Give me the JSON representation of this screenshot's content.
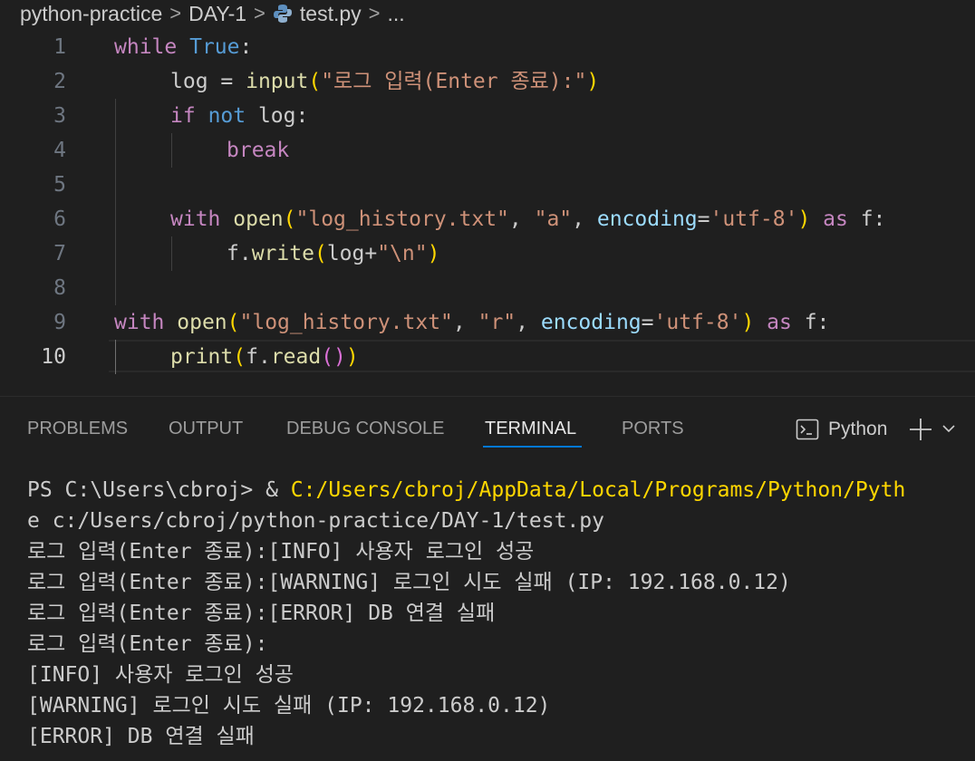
{
  "breadcrumb": {
    "items": [
      "python-practice",
      "DAY-1",
      "test.py",
      "..."
    ],
    "file_icon": "python-icon"
  },
  "editor": {
    "active_line": 10,
    "line_numbers": [
      "1",
      "2",
      "3",
      "4",
      "5",
      "6",
      "7",
      "8",
      "9",
      "10"
    ],
    "l1": {
      "t0": "while",
      "t1": " ",
      "t2": "True",
      "t3": ":"
    },
    "l2": {
      "t0": "log",
      "t1": " = ",
      "t2": "input",
      "t3": "(",
      "t4": "\"로그 입력(Enter 종료):\"",
      "t5": ")"
    },
    "l3": {
      "t0": "if",
      "t1": " ",
      "t2": "not",
      "t3": " log:"
    },
    "l4": {
      "t0": "break"
    },
    "l6": {
      "t0": "with",
      "t1": " ",
      "t2": "open",
      "t3": "(",
      "t4": "\"log_history.txt\"",
      "t5": ", ",
      "t6": "\"a\"",
      "t7": ", ",
      "t8": "encoding",
      "t9": "=",
      "t10": "'utf-8'",
      "t11": ")",
      "t12": " ",
      "t13": "as",
      "t14": " f:"
    },
    "l7": {
      "t0": "f.",
      "t1": "write",
      "t2": "(",
      "t3": "log+",
      "t4": "\"\\n\"",
      "t5": ")"
    },
    "l9": {
      "t0": "with",
      "t1": " ",
      "t2": "open",
      "t3": "(",
      "t4": "\"log_history.txt\"",
      "t5": ", ",
      "t6": "\"r\"",
      "t7": ", ",
      "t8": "encoding",
      "t9": "=",
      "t10": "'utf-8'",
      "t11": ")",
      "t12": " ",
      "t13": "as",
      "t14": " f:"
    },
    "l10": {
      "t0": "print",
      "t1": "(",
      "t2": "f.",
      "t3": "read",
      "t4": "()",
      "t5": ")"
    }
  },
  "panel": {
    "tabs": [
      "PROBLEMS",
      "OUTPUT",
      "DEBUG CONSOLE",
      "TERMINAL",
      "PORTS"
    ],
    "active_tab": "TERMINAL",
    "terminal_name": "Python"
  },
  "terminal": {
    "prompt": "PS C:\\Users\\cbroj> & ",
    "exe_path": "C:/Users/cbroj/AppData/Local/Programs/Python/Pyth",
    "line2": "e c:/Users/cbroj/python-practice/DAY-1/test.py",
    "lines": [
      "로그 입력(Enter 종료):[INFO] 사용자 로그인 성공",
      "로그 입력(Enter 종료):[WARNING] 로그인 시도 실패 (IP: 192.168.0.12)",
      "로그 입력(Enter 종료):[ERROR] DB 연결 실패",
      "로그 입력(Enter 종료):",
      "[INFO] 사용자 로그인 성공",
      "[WARNING] 로그인 시도 실패 (IP: 192.168.0.12)",
      "[ERROR] DB 연결 실패"
    ]
  },
  "colors": {
    "background": "#1f1f1f",
    "keyword": "#c586c0",
    "builtin_constant": "#569cd6",
    "function": "#dcdcaa",
    "string": "#ce9178",
    "parameter": "#9cdcfe",
    "bracket_level1": "#ffd700",
    "bracket_level2": "#da70d6",
    "active_tab_underline": "#0078d4"
  }
}
